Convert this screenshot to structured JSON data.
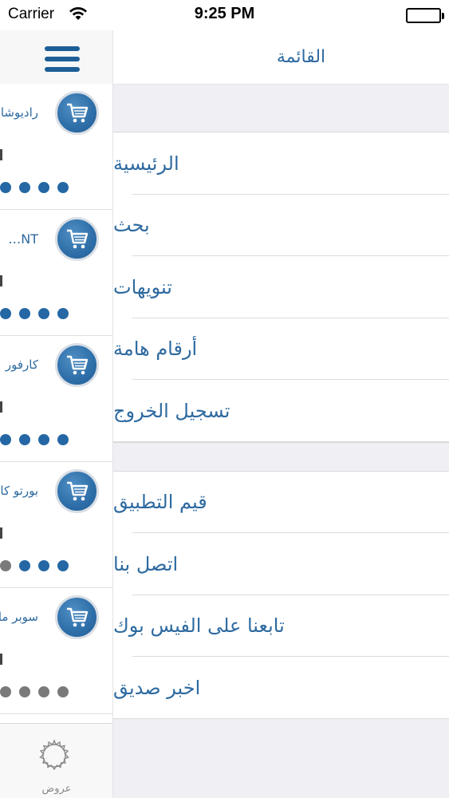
{
  "status_bar": {
    "carrier": "Carrier",
    "time": "9:25 PM"
  },
  "menu": {
    "title": "القائمة",
    "group1": [
      "الرئيسية",
      "بحث",
      "تنويهات",
      "أرقام هامة",
      "تسجيل الخروج"
    ],
    "group2": [
      "قيم التطبيق",
      "اتصل بنا",
      "تابعنا على الفيس بوك",
      "اخبر صديق"
    ]
  },
  "offers_list": {
    "items": [
      {
        "name": "راديوشاك",
        "rating_dots": 4,
        "dot_color": "#2467a4"
      },
      {
        "name": "…NT",
        "rating_dots": 4,
        "dot_color": "#2467a4"
      },
      {
        "name": "كارفور",
        "rating_dots": 4,
        "dot_color": "#2467a4"
      },
      {
        "name": "بورتو كافيه",
        "rating_dots": 4,
        "dot_color": "mixed"
      },
      {
        "name": "سوبر ماركت",
        "rating_dots": 4,
        "dot_color": "#7a7a7a"
      }
    ]
  },
  "tabbar": {
    "offers_label": "عروض"
  },
  "colors": {
    "accent": "#2e6aa0",
    "dot_blue": "#2467a4",
    "dot_grey": "#7a7a7a"
  }
}
